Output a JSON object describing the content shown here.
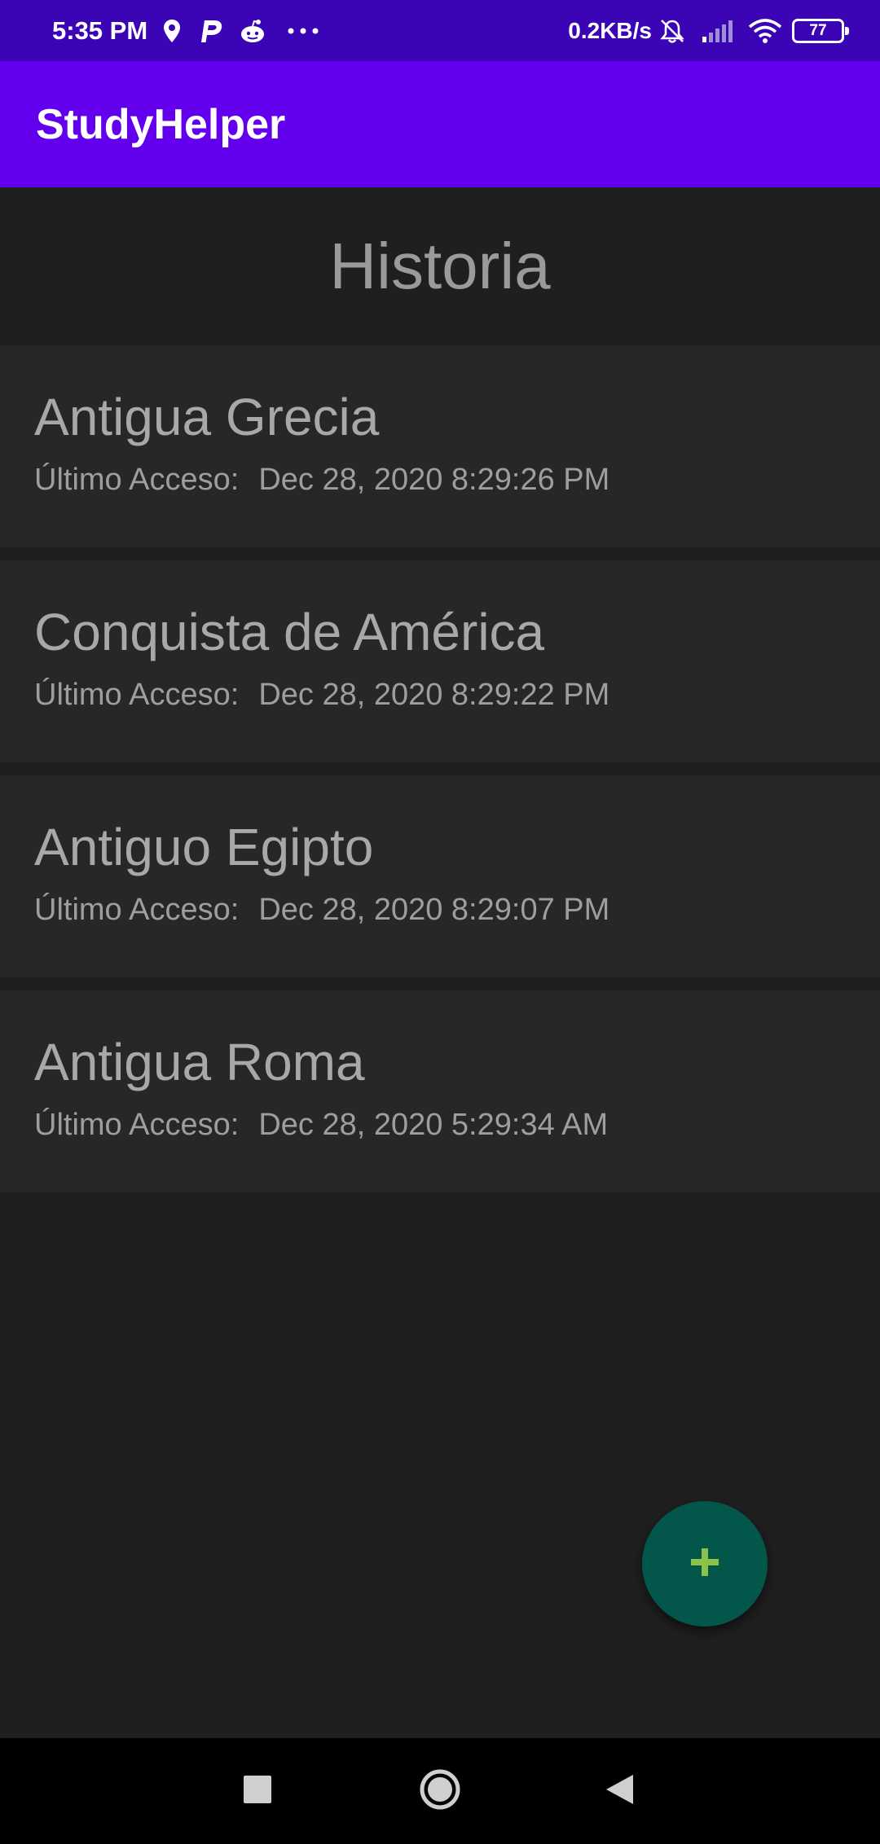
{
  "status_bar": {
    "time": "5:35 PM",
    "speed": "0.2KB/s",
    "battery": "77",
    "icons": [
      "location-icon",
      "parking-icon",
      "reddit-icon",
      "more-dots-icon",
      "bell-muted-icon",
      "signal-icon",
      "wifi-icon",
      "battery-icon"
    ]
  },
  "app_bar": {
    "title": "StudyHelper"
  },
  "section": {
    "title": "Historia"
  },
  "topics": [
    {
      "title": "Antigua Grecia",
      "label": "Último Acceso:",
      "date": "Dec 28, 2020 8:29:26 PM"
    },
    {
      "title": "Conquista de América",
      "label": "Último Acceso:",
      "date": "Dec 28, 2020 8:29:22 PM"
    },
    {
      "title": "Antiguo Egipto",
      "label": "Último Acceso:",
      "date": "Dec 28, 2020 8:29:07 PM"
    },
    {
      "title": "Antigua Roma",
      "label": "Último Acceso:",
      "date": "Dec 28, 2020 5:29:34 AM"
    }
  ],
  "fab": {
    "icon": "plus-icon",
    "color": "#8bc34a",
    "background": "#03574a"
  },
  "nav_bar": {
    "icons": [
      "recents-square-icon",
      "home-circle-icon",
      "back-triangle-icon"
    ]
  },
  "colors": {
    "status_bar": "#3b04b4",
    "app_bar": "#6200ee",
    "background": "#1f1f1f",
    "card": "#272727"
  }
}
